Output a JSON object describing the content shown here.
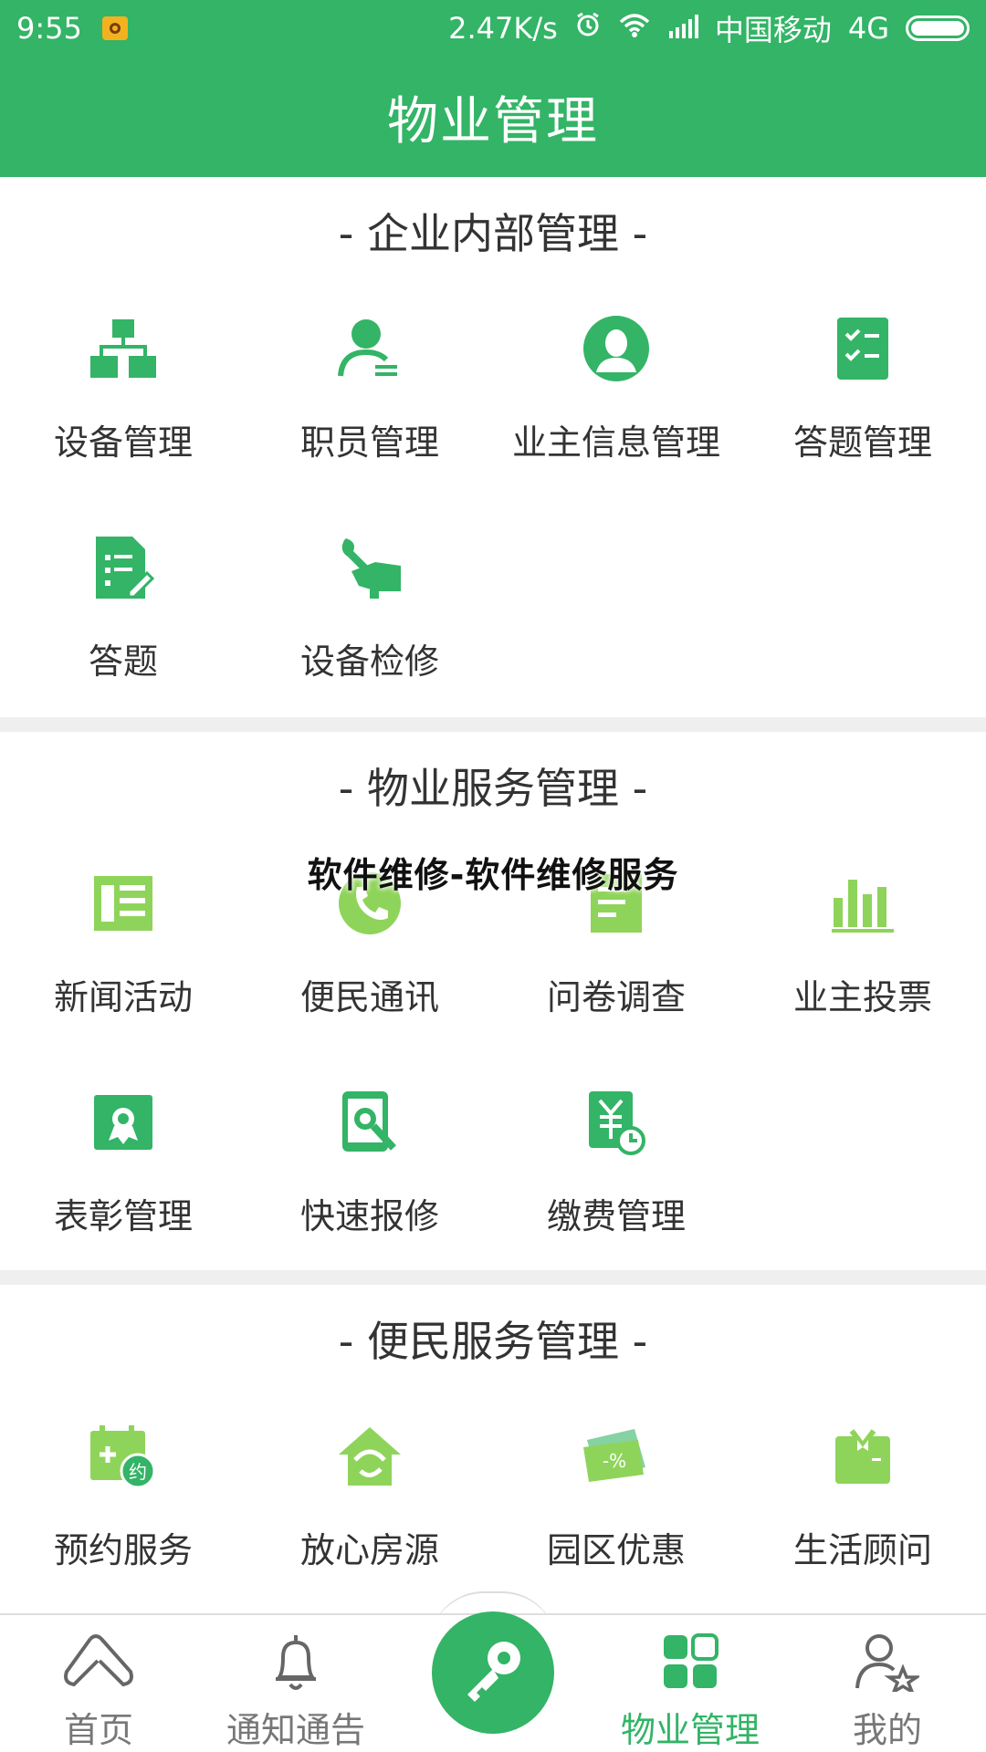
{
  "status": {
    "time": "9:55",
    "speed": "2.47K/s",
    "carrier": "中国移动",
    "network": "4G"
  },
  "header": {
    "title": "物业管理"
  },
  "watermark": "软件维修-软件维修服务",
  "colors": {
    "brand": "#33b466",
    "accent_light": "#8fd45a",
    "text": "#333333"
  },
  "sections": [
    {
      "title": "- 企业内部管理 -",
      "items": [
        {
          "label": "设备管理",
          "icon": "org-chart-icon"
        },
        {
          "label": "职员管理",
          "icon": "staff-icon"
        },
        {
          "label": "业主信息管理",
          "icon": "owner-avatar-icon"
        },
        {
          "label": "答题管理",
          "icon": "checklist-icon"
        },
        {
          "label": "答题",
          "icon": "document-edit-icon"
        },
        {
          "label": "设备检修",
          "icon": "wrench-hand-icon"
        }
      ]
    },
    {
      "title": "- 物业服务管理 -",
      "items": [
        {
          "label": "新闻活动",
          "icon": "news-icon"
        },
        {
          "label": "便民通讯",
          "icon": "phone-icon"
        },
        {
          "label": "问卷调查",
          "icon": "survey-icon"
        },
        {
          "label": "业主投票",
          "icon": "bar-chart-icon"
        },
        {
          "label": "表彰管理",
          "icon": "award-icon"
        },
        {
          "label": "快速报修",
          "icon": "repair-search-icon"
        },
        {
          "label": "缴费管理",
          "icon": "yuan-clock-icon"
        }
      ]
    },
    {
      "title": "- 便民服务管理 -",
      "items": [
        {
          "label": "预约服务",
          "icon": "calendar-appointment-icon"
        },
        {
          "label": "放心房源",
          "icon": "house-icon"
        },
        {
          "label": "园区优惠",
          "icon": "discount-ticket-icon"
        },
        {
          "label": "生活顾问",
          "icon": "consultant-icon"
        }
      ]
    }
  ],
  "appointment_badge": "约",
  "discount_badge": "-%",
  "tabs": [
    {
      "label": "首页",
      "icon": "home-icon"
    },
    {
      "label": "通知通告",
      "icon": "bell-icon"
    },
    {
      "label": "",
      "icon": "key-icon"
    },
    {
      "label": "物业管理",
      "icon": "grid-icon",
      "active": true
    },
    {
      "label": "我的",
      "icon": "user-star-icon"
    }
  ]
}
